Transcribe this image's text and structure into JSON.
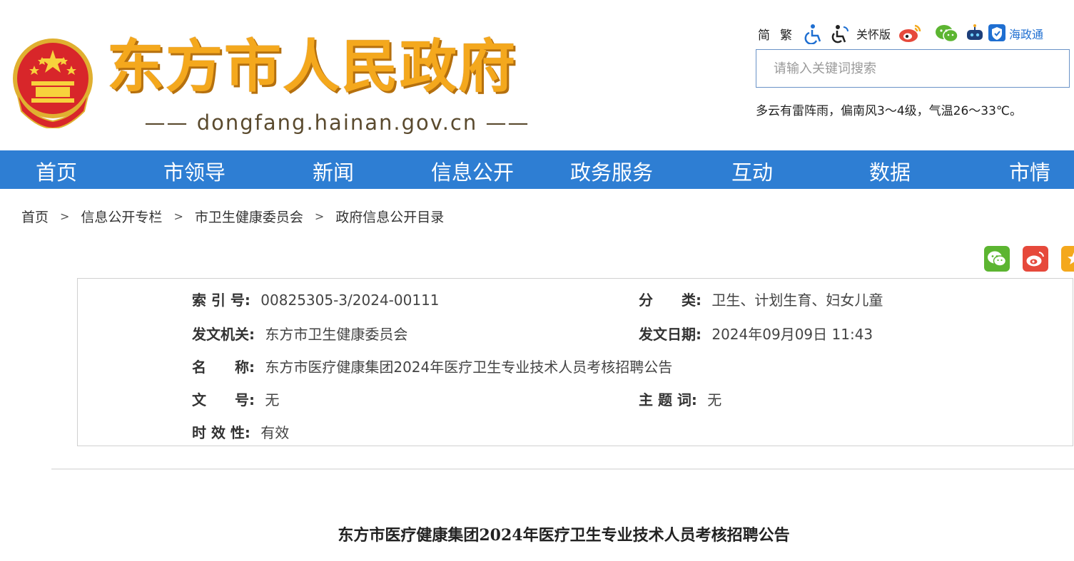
{
  "header": {
    "site_name": "东方市人民政府",
    "domain_text": "—— dongfang.hainan.gov.cn ——",
    "tools": {
      "simplified": "简",
      "traditional": "繁",
      "care_mode": "关怀版",
      "hainan_app": "海政通"
    },
    "search": {
      "placeholder": "请输入关键词搜索",
      "value": ""
    },
    "weather": "多云有雷阵雨，偏南风3～4级，气温26～33℃。"
  },
  "nav": {
    "items": [
      "首页",
      "市领导",
      "新闻",
      "信息公开",
      "政务服务",
      "互动",
      "数据",
      "市情"
    ]
  },
  "breadcrumb": {
    "items": [
      "首页",
      "信息公开专栏",
      "市卫生健康委员会",
      "政府信息公开目录"
    ],
    "separator": ">"
  },
  "info": {
    "index_no": {
      "label": "索 引 号:",
      "value": "00825305-3/2024-00111"
    },
    "category": {
      "label": "分　　类:",
      "value": "卫生、计划生育、妇女儿童"
    },
    "issuer": {
      "label": "发文机关:",
      "value": "东方市卫生健康委员会"
    },
    "issue_date": {
      "label": "发文日期:",
      "value": "2024年09月09日 11:43"
    },
    "name": {
      "label": "名　　称:",
      "value": "东方市医疗健康集团2024年医疗卫生专业技术人员考核招聘公告"
    },
    "doc_no": {
      "label": "文　　号:",
      "value": "无"
    },
    "keywords": {
      "label": "主 题 词:",
      "value": "无"
    },
    "validity": {
      "label": "时 效 性:",
      "value": "有效"
    }
  },
  "article": {
    "title": "东方市医疗健康集团2024年医疗卫生专业技术人员考核招聘公告"
  },
  "colors": {
    "nav_bg": "#2e7ed3",
    "title_gold": "#f4a81d",
    "wechat_green": "#5cb531",
    "weibo_red": "#e6493b"
  }
}
